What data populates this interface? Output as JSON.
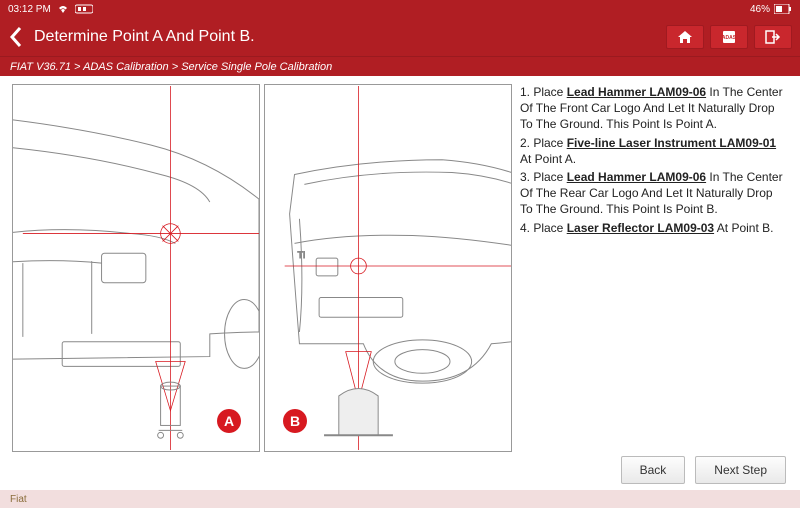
{
  "status": {
    "time": "03:12 PM",
    "battery": "46%"
  },
  "header": {
    "title": "Determine Point A And Point B."
  },
  "breadcrumb": "FIAT V36.71 > ADAS Calibration > Service Single Pole Calibration",
  "badges": {
    "a": "A",
    "b": "B"
  },
  "instructions": {
    "step1_prefix": "1. Place ",
    "step1_tool": "Lead Hammer LAM09-06",
    "step1_suffix": " In The Center Of The Front Car Logo And Let It Naturally Drop To The Ground. This Point Is Point A.",
    "step2_prefix": "2. Place ",
    "step2_tool": "Five-line Laser Instrument LAM09-01",
    "step2_suffix": " At Point A.",
    "step3_prefix": "3. Place ",
    "step3_tool": "Lead Hammer LAM09-06",
    "step3_suffix": " In The Center Of The Rear Car Logo And Let It Naturally Drop To The Ground. This Point Is Point B.",
    "step4_prefix": "4. Place ",
    "step4_tool": "Laser Reflector LAM09-03",
    "step4_suffix": " At Point B."
  },
  "buttons": {
    "back": "Back",
    "next": "Next Step"
  },
  "footer": {
    "brand": "Fiat"
  }
}
